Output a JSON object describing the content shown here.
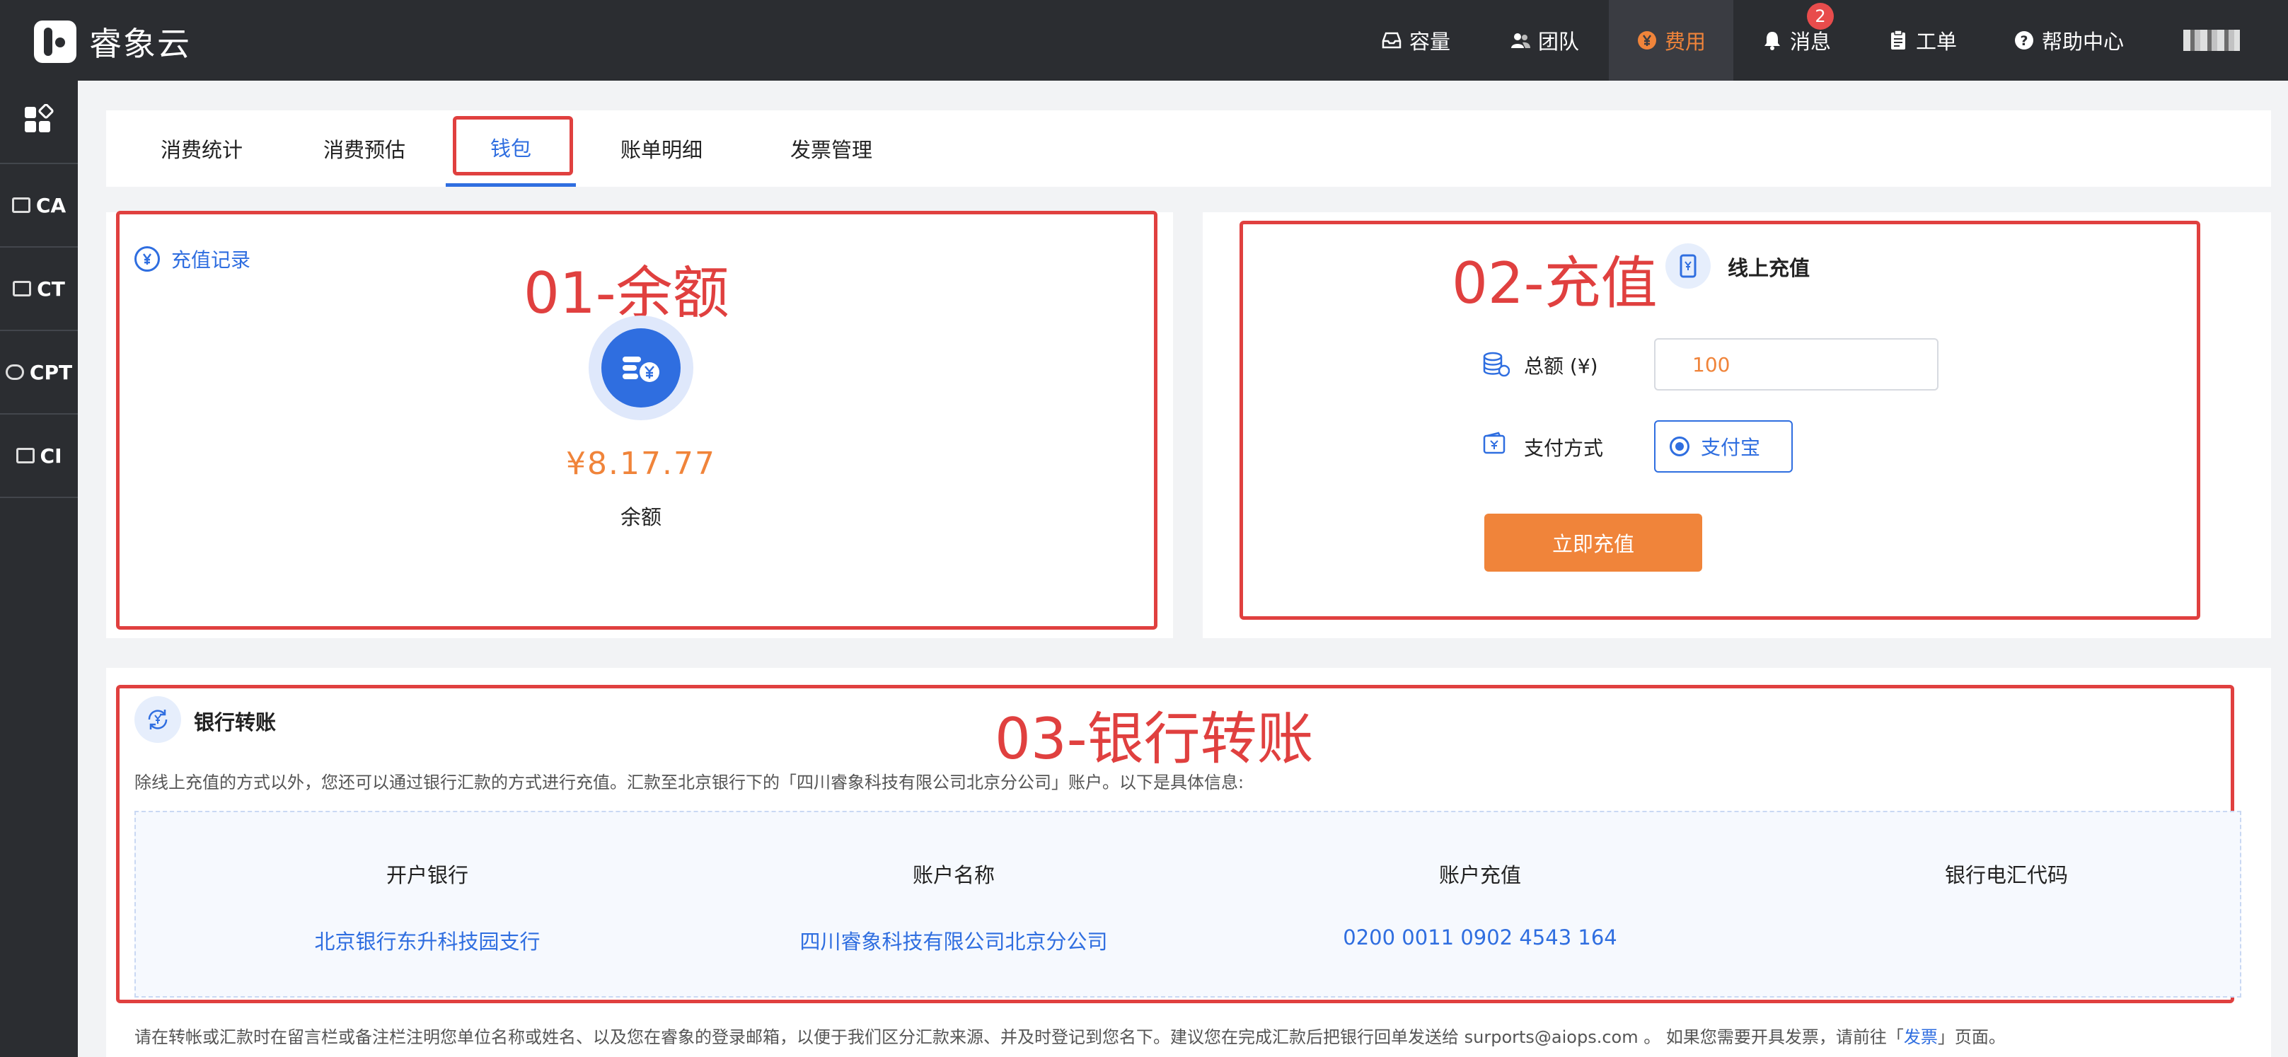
{
  "app": {
    "name": "睿象云"
  },
  "nav": {
    "items": [
      {
        "label": "容量",
        "icon": "tray-icon"
      },
      {
        "label": "团队",
        "icon": "team-icon"
      },
      {
        "label": "费用",
        "icon": "yen-icon",
        "active": true
      },
      {
        "label": "消息",
        "icon": "bell-icon",
        "badge": "2"
      },
      {
        "label": "工单",
        "icon": "clipboard-icon"
      },
      {
        "label": "帮助中心",
        "icon": "help-icon"
      }
    ]
  },
  "sidebar": {
    "items": [
      {
        "label": "",
        "icon": "apps-icon"
      },
      {
        "label": "CA",
        "icon": "monitor-icon"
      },
      {
        "label": "CT",
        "icon": "monitor-icon"
      },
      {
        "label": "CPT",
        "icon": "cloud-icon"
      },
      {
        "label": "CI",
        "icon": "monitor-icon"
      }
    ]
  },
  "tabs": [
    {
      "label": "消费统计"
    },
    {
      "label": "消费预估"
    },
    {
      "label": "钱包",
      "active": true
    },
    {
      "label": "账单明细"
    },
    {
      "label": "发票管理"
    }
  ],
  "balance": {
    "records_link": "充值记录",
    "amount": "¥8.17.77",
    "label": "余额",
    "annotation": "01-余额"
  },
  "recharge": {
    "title": "线上充值",
    "annotation": "02-充值",
    "amount_label": "总额 (¥)",
    "amount_value": "100",
    "method_label": "支付方式",
    "method_option": "支付宝",
    "submit_label": "立即充值"
  },
  "bank": {
    "title": "银行转账",
    "annotation": "03-银行转账",
    "intro": "除线上充值的方式以外，您还可以通过银行汇款的方式进行充值。汇款至北京银行下的「四川睿象科技有限公司北京分公司」账户。以下是具体信息:",
    "columns": [
      {
        "header": "开户银行",
        "value": "北京银行东升科技园支行"
      },
      {
        "header": "账户名称",
        "value": "四川睿象科技有限公司北京分公司"
      },
      {
        "header": "账户充值",
        "value": "0200 0011 0902 4543 164"
      },
      {
        "header": "银行电汇代码",
        "value": ""
      }
    ],
    "footnote_pre": "请在转帐或汇款时在留言栏或备注栏注明您单位名称或姓名、以及您在睿象的登录邮箱，以便于我们区分汇款来源、并及时登记到您名下。建议您在完成汇款后把银行回单发送给 surports@aiops.com 。 如果您需要开具发票，请前往「",
    "footnote_link": "发票",
    "footnote_post": "」页面。"
  },
  "colors": {
    "accent": "#f0843a",
    "primary": "#2f6ee0",
    "annotation": "#e0403f",
    "nav_bg": "#2b2d31"
  }
}
